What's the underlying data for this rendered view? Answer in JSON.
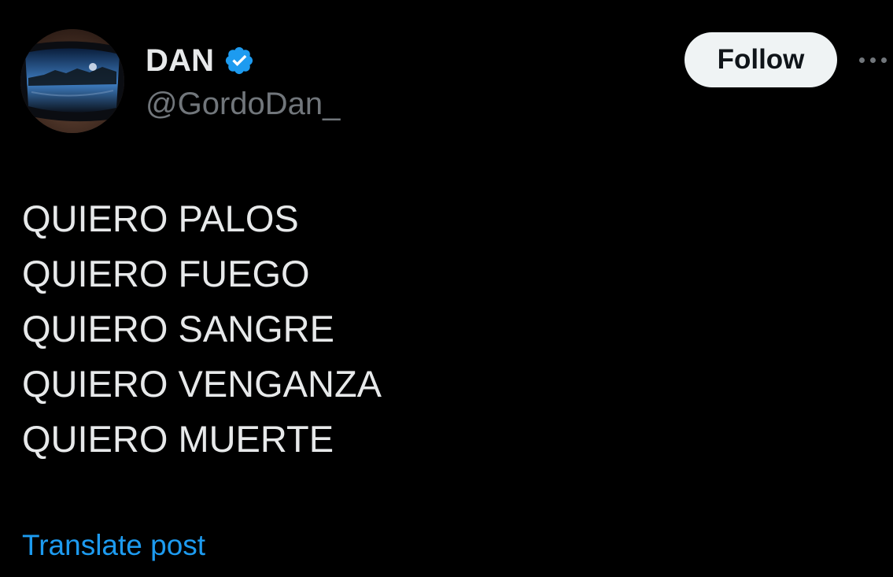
{
  "author": {
    "display_name": "DAN",
    "handle": "@GordoDan_",
    "verified_icon": "verified-badge-icon",
    "avatar_icon": "avatar-sunglasses-reflection"
  },
  "actions": {
    "follow_label": "Follow",
    "more_icon": "more-horizontal-icon"
  },
  "post": {
    "lines": [
      "QUIERO PALOS",
      "QUIERO FUEGO",
      "QUIERO SANGRE",
      "QUIERO VENGANZA",
      "QUIERO MUERTE"
    ],
    "translate_label": "Translate post"
  },
  "colors": {
    "background": "#000000",
    "primary_text": "#e7e9ea",
    "secondary_text": "#71767b",
    "accent": "#1d9bf0",
    "follow_button_bg": "#eff3f4"
  }
}
